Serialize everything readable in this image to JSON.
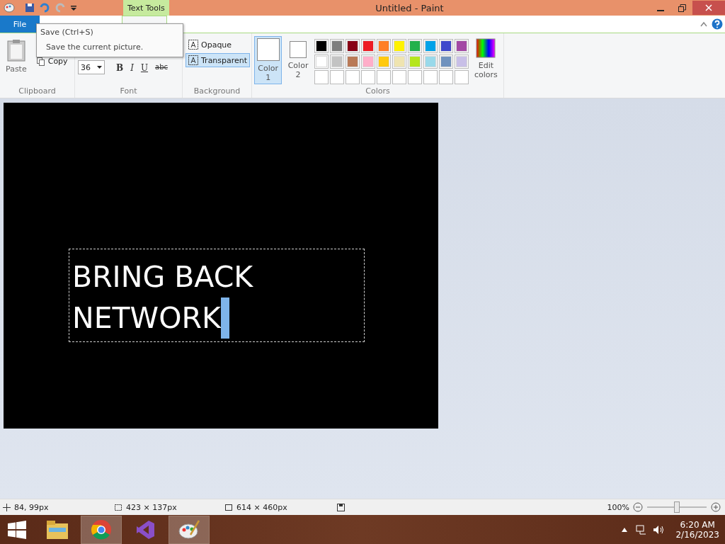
{
  "window": {
    "title": "Untitled - Paint",
    "context_tab": "Text Tools"
  },
  "tabs": [
    {
      "label": "File",
      "kind": "file"
    }
  ],
  "tooltip": {
    "title": "Save (Ctrl+S)",
    "description": "Save the current picture."
  },
  "clipboard": {
    "label": "Clipboard",
    "paste": "Paste",
    "copy": {
      "label": "Copy",
      "disabled": false
    }
  },
  "font": {
    "label": "Font",
    "size": "36",
    "styles": [
      {
        "label": "B",
        "kind": "bold"
      },
      {
        "label": "I",
        "kind": "italic"
      },
      {
        "label": "U",
        "kind": "underline"
      },
      {
        "label": "abc",
        "kind": "strike"
      }
    ]
  },
  "background": {
    "label": "Background",
    "options": [
      {
        "label": "Opaque",
        "selected": false
      },
      {
        "label": "Transparent",
        "selected": true
      }
    ]
  },
  "colors": {
    "label": "Colors",
    "slots": [
      {
        "label": "Color 1",
        "selected": true
      },
      {
        "label": "Color 2",
        "selected": false
      }
    ],
    "edit": "Edit colors",
    "palette": [
      {
        "color": "#000000"
      },
      {
        "color": "#7f7f7f"
      },
      {
        "color": "#880015"
      },
      {
        "color": "#ed1c24"
      },
      {
        "color": "#ff7f27"
      },
      {
        "color": "#fff200"
      },
      {
        "color": "#22b14c"
      },
      {
        "color": "#00a2e8"
      },
      {
        "color": "#3f48cc"
      },
      {
        "color": "#a349a4"
      },
      {
        "color": "#ffffff"
      },
      {
        "color": "#c3c3c3"
      },
      {
        "color": "#b97a57"
      },
      {
        "color": "#ffaec9"
      },
      {
        "color": "#ffc90e"
      },
      {
        "color": "#efe4b0"
      },
      {
        "color": "#b5e61d"
      },
      {
        "color": "#99d9ea"
      },
      {
        "color": "#7092be"
      },
      {
        "color": "#c8bfe7"
      }
    ]
  },
  "canvas": {
    "text_lines": [
      "BRING BACK",
      "NETWORK"
    ]
  },
  "status_bar": {
    "cursor": "84, 99px",
    "selection": "423 × 137px",
    "size": "614 × 460px",
    "zoom": "100%",
    "level": 0.5
  },
  "taskbar": {
    "apps": [
      {
        "kind": "explorer",
        "selected": false
      },
      {
        "kind": "chrome",
        "selected": true
      },
      {
        "kind": "studio",
        "selected": false
      },
      {
        "kind": "paint",
        "selected": true
      }
    ],
    "time": "6:20 AM",
    "date": "2/16/2023"
  }
}
